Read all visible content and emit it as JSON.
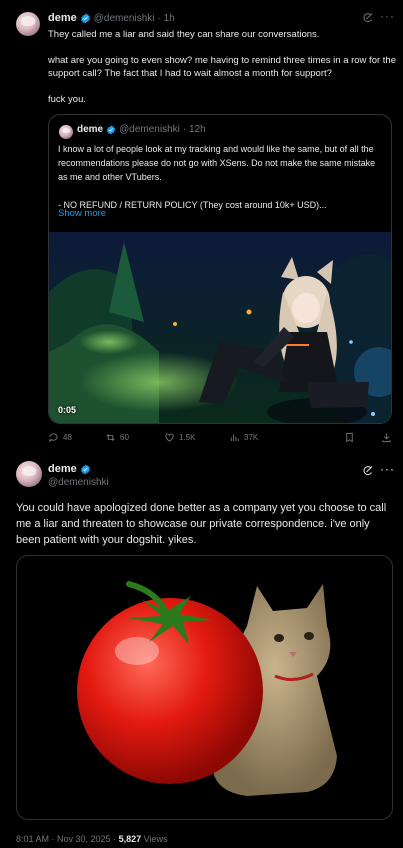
{
  "reply_post": {
    "author_name": "deme",
    "author_handle": "@demenishki",
    "time": "· 1h",
    "text": "They called me a liar and said they can share our conversations.\n\nwhat are you going to even show? me having to remind three times in a row for the support call? The fact that I had to wait almost a month for support?\n\nfuck you.",
    "quote": {
      "author_name": "deme",
      "author_handle": "@demenishki",
      "time": "· 12h",
      "text": "I know a lot of people look at my tracking and would like the same, but of all the recommendations please do not go with XSens. Do not make the same mistake as me and other VTubers.\n\n- NO REFUND / RETURN POLICY (They cost around 10k+ USD)...",
      "show_more": "Show more",
      "video_time": "0:05"
    },
    "stats": {
      "replies": "48",
      "reposts": "60",
      "likes": "1.5K",
      "views": "37K"
    }
  },
  "main_post": {
    "author_name": "deme",
    "author_handle": "@demenishki",
    "text": "You could have apologized done better as a company yet you choose to call me a liar and threaten to showcase our private correspondence. i've only been patient with your dogshit. yikes.",
    "meta_time": "8:01 AM · Nov 30, 2025 · ",
    "meta_views_count": "5,827",
    "meta_views_label": " Views"
  },
  "colors": {
    "background": "#000000",
    "text": "#e7e9ea",
    "muted": "#71767b",
    "accent": "#1d9bf0",
    "border": "#2f3336"
  },
  "icons": [
    "verified-badge-icon",
    "grok-icon",
    "more-icon",
    "reply-icon",
    "repost-icon",
    "like-icon",
    "views-icon",
    "bookmark-icon",
    "share-icon"
  ]
}
